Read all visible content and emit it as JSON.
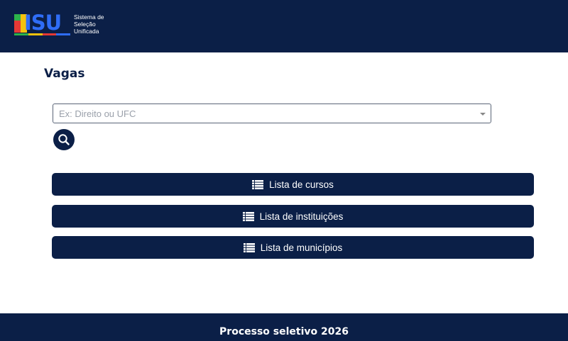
{
  "header": {
    "logo_letters": "ISU",
    "logo_text": [
      "Sistema de",
      "Seleção",
      "Unificada"
    ],
    "colors": {
      "background": "#0b1f47",
      "logo_blue": "#2f6df6",
      "green": "#2db34a",
      "yellow": "#f4c20d",
      "red": "#e53935"
    }
  },
  "page": {
    "title": "Vagas"
  },
  "search": {
    "placeholder": "Ex: Direito ou UFC",
    "value": "",
    "button_icon": "search-icon"
  },
  "buttons": [
    {
      "label": "Lista de cursos",
      "icon": "list-icon"
    },
    {
      "label": "Lista de instituições",
      "icon": "list-icon"
    },
    {
      "label": "Lista de municípios",
      "icon": "list-icon"
    }
  ],
  "footer": {
    "text": "Processo seletivo 2026"
  }
}
